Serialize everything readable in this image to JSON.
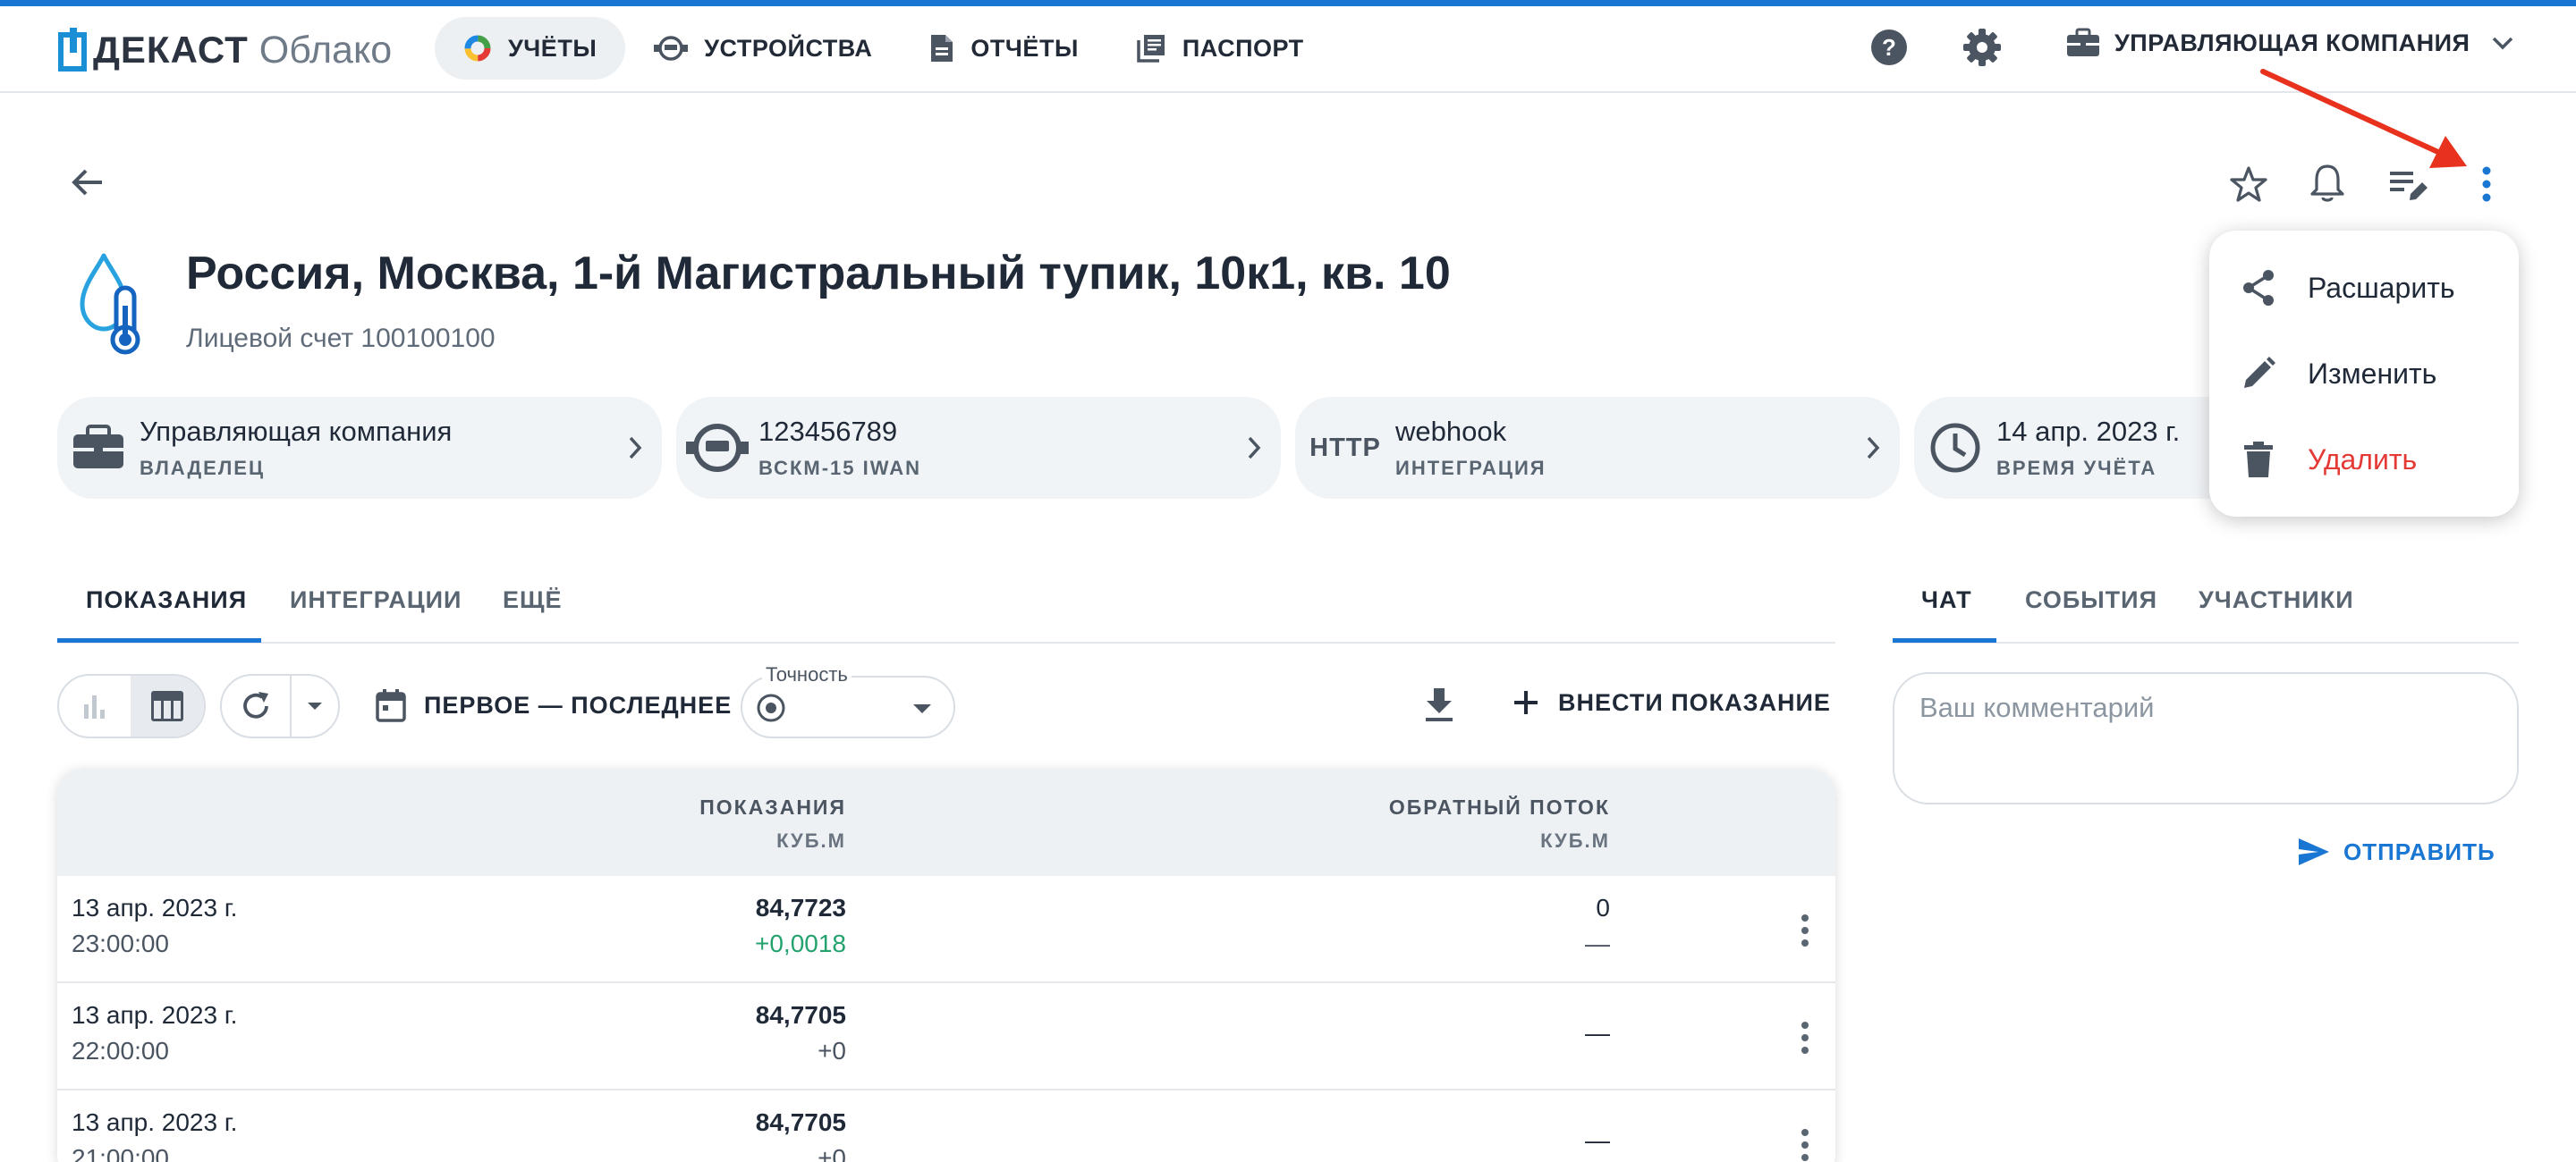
{
  "app": {
    "brand_word": "ДЕКАСТ",
    "brand_sub": "Облако",
    "accent": "#1976d2"
  },
  "nav": {
    "items": [
      {
        "label": "УЧЁТЫ",
        "icon": "donut-chart-icon",
        "active": true
      },
      {
        "label": "УСТРОЙСТВА",
        "icon": "meter-icon",
        "active": false
      },
      {
        "label": "ОТЧЁТЫ",
        "icon": "document-icon",
        "active": false
      },
      {
        "label": "ПАСПОРТ",
        "icon": "library-icon",
        "active": false
      }
    ],
    "company_label": "УПРАВЛЯЮЩАЯ КОМПАНИЯ"
  },
  "header": {
    "title": "Россия, Москва, 1-й Магистральный тупик, 10к1, кв. 10",
    "subtitle": "Лицевой счет 100100100"
  },
  "chips": [
    {
      "title": "Управляющая компания",
      "sub": "ВЛАДЕЛЕЦ",
      "icon": "briefcase-icon"
    },
    {
      "title": "123456789",
      "sub": "ВСКМ-15 IWAN",
      "icon": "meter-icon"
    },
    {
      "title": "webhook",
      "sub": "ИНТЕГРАЦИЯ",
      "icon_text": "HTTP"
    },
    {
      "title": "14 апр. 2023 г.",
      "sub": "ВРЕМЯ УЧЁТА",
      "icon": "clock-icon"
    }
  ],
  "tabs_left": [
    {
      "label": "ПОКАЗАНИЯ",
      "active": true
    },
    {
      "label": "ИНТЕГРАЦИИ",
      "active": false
    },
    {
      "label": "ЕЩЁ",
      "active": false
    }
  ],
  "tabs_right": [
    {
      "label": "ЧАТ",
      "active": true
    },
    {
      "label": "СОБЫТИЯ",
      "active": false
    },
    {
      "label": "УЧАСТНИКИ",
      "active": false
    }
  ],
  "toolbar": {
    "period_label": "ПЕРВОЕ — ПОСЛЕДНЕЕ",
    "precision_label": "Точность",
    "add_label": "ВНЕСТИ ПОКАЗАНИЕ"
  },
  "table": {
    "col1_header": "ПОКАЗАНИЯ",
    "col1_unit": "КУБ.М",
    "col2_header": "ОБРАТНЫЙ ПОТОК",
    "col2_unit": "КУБ.М",
    "rows": [
      {
        "date": "13 апр. 2023 г.",
        "time": "23:00:00",
        "value": "84,7723",
        "delta": "+0,0018",
        "reverse": "0",
        "reverse_sub": "—"
      },
      {
        "date": "13 апр. 2023 г.",
        "time": "22:00:00",
        "value": "84,7705",
        "delta": "+0",
        "reverse": "—",
        "reverse_sub": ""
      },
      {
        "date": "13 апр. 2023 г.",
        "time": "21:00:00",
        "value": "84,7705",
        "delta": "+0",
        "reverse": "—",
        "reverse_sub": ""
      }
    ]
  },
  "chat": {
    "placeholder": "Ваш комментарий",
    "send_label": "ОТПРАВИТЬ"
  },
  "menu": {
    "items": [
      {
        "label": "Расшарить",
        "icon": "share-icon"
      },
      {
        "label": "Изменить",
        "icon": "pencil-icon"
      },
      {
        "label": "Удалить",
        "icon": "trash-icon",
        "color": "#e53935"
      }
    ]
  },
  "colors": {
    "delta_positive": "#23a26d",
    "annotation_arrow": "#e8321e"
  }
}
